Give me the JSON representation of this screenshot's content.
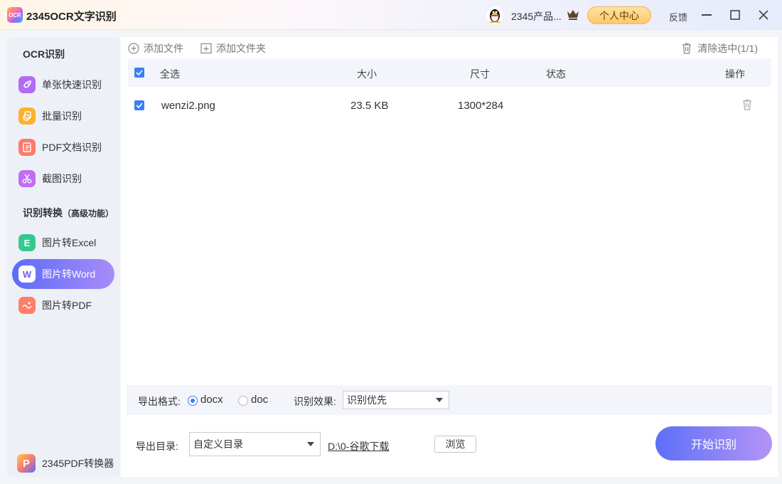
{
  "app": {
    "title": "2345OCR文字识别",
    "logo_text": "OCR"
  },
  "header": {
    "user_name": "2345产品...",
    "personal_center": "个人中心",
    "feedback": "反馈"
  },
  "sidebar": {
    "section1": "OCR识别",
    "section2": "识别转换",
    "section2_note": "（高级功能）",
    "items": [
      {
        "label": "单张快速识别",
        "icon": "rocket-icon",
        "color": "#b06cf5"
      },
      {
        "label": "批量识别",
        "icon": "batch-icon",
        "color": "#ffb02e"
      },
      {
        "label": "PDF文档识别",
        "icon": "pdf-doc-icon",
        "color": "#ff7a6a"
      },
      {
        "label": "截图识别",
        "icon": "scissors-icon",
        "color": "#c06cf5"
      },
      {
        "label": "图片转Excel",
        "icon": "excel-icon",
        "color": "#36c98e",
        "glyph": "E"
      },
      {
        "label": "图片转Word",
        "icon": "word-icon",
        "color": "#5b6cf7",
        "glyph": "W",
        "active": true
      },
      {
        "label": "图片转PDF",
        "icon": "image-pdf-icon",
        "color": "#ff7f6b"
      }
    ],
    "bottom_tool": "2345PDF转换器"
  },
  "toolbar": {
    "add_file": "添加文件",
    "add_folder": "添加文件夹",
    "clear_selected": "清除选中(1/1)"
  },
  "table": {
    "headers": {
      "select_all": "全选",
      "size": "大小",
      "dimensions": "尺寸",
      "status": "状态",
      "action": "操作"
    },
    "rows": [
      {
        "name": "wenzi2.png",
        "size": "23.5 KB",
        "dimensions": "1300*284",
        "status": "",
        "checked": true
      }
    ]
  },
  "options": {
    "format_label": "导出格式:",
    "format_options": [
      "docx",
      "doc"
    ],
    "format_selected": "docx",
    "effect_label": "识别效果:",
    "effect_value": "识别优先"
  },
  "output": {
    "dir_label": "导出目录:",
    "dir_select": "自定义目录",
    "dir_path": "D:\\0-谷歌下载",
    "browse": "浏览",
    "start": "开始识别"
  },
  "colors": {
    "accent": "#3d7df6",
    "gradient_start": "#5d6ff7",
    "gradient_end": "#b494f7"
  }
}
